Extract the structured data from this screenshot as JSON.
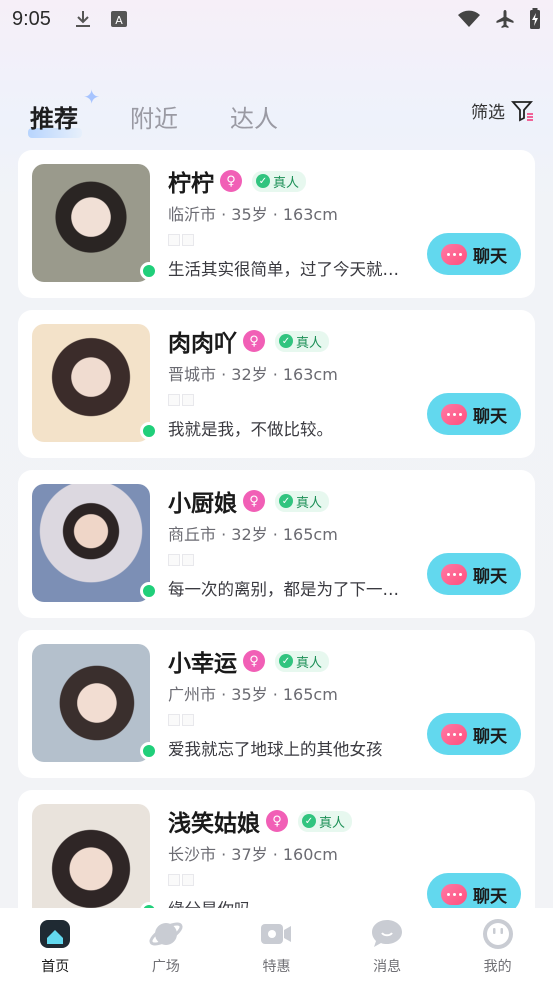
{
  "status_bar": {
    "time": "9:05",
    "left_icons": [
      "download-icon",
      "keyboard-a-icon"
    ],
    "right_icons": [
      "wifi-icon",
      "airplane-icon",
      "battery-charging-icon"
    ]
  },
  "tabs": [
    {
      "label": "推荐",
      "active": true
    },
    {
      "label": "附近",
      "active": false
    },
    {
      "label": "达人",
      "active": false
    }
  ],
  "filter": {
    "label": "筛选",
    "icon": "filter-icon"
  },
  "verified_label": "真人",
  "chat_label": "聊天",
  "cards": [
    {
      "name": "柠柠",
      "info": "临沂市 · 35岁 · 163cm",
      "bio": "生活其实很简单，过了今天就…",
      "online": true,
      "avatar_colors": [
        "#8a8f7a",
        "#e9ddd4"
      ]
    },
    {
      "name": "肉肉吖",
      "info": "晋城市 · 32岁 · 163cm",
      "bio": "我就是我，不做比较。",
      "online": true,
      "avatar_colors": [
        "#f3e2c9",
        "#3b2c2a"
      ]
    },
    {
      "name": "小厨娘",
      "info": "商丘市 · 32岁 · 165cm",
      "bio": "每一次的离别，都是为了下一…",
      "online": true,
      "avatar_colors": [
        "#7c8fb5",
        "#d9d4dc"
      ]
    },
    {
      "name": "小幸运",
      "info": "广州市 · 35岁 · 165cm",
      "bio": "爱我就忘了地球上的其他女孩",
      "online": true,
      "avatar_colors": [
        "#a8b6c5",
        "#e4cfc5"
      ]
    },
    {
      "name": "浅笑姑娘",
      "info": "长沙市 · 37岁 · 160cm",
      "bio": "缘分是你吗",
      "online": true,
      "avatar_colors": [
        "#e9e3dc",
        "#3a3030"
      ]
    }
  ],
  "bottom_nav": [
    {
      "label": "首页",
      "icon": "home-icon",
      "active": true
    },
    {
      "label": "广场",
      "icon": "planet-icon",
      "active": false
    },
    {
      "label": "特惠",
      "icon": "video-camera-icon",
      "active": false
    },
    {
      "label": "消息",
      "icon": "message-bubble-icon",
      "active": false
    },
    {
      "label": "我的",
      "icon": "profile-face-icon",
      "active": false
    }
  ]
}
